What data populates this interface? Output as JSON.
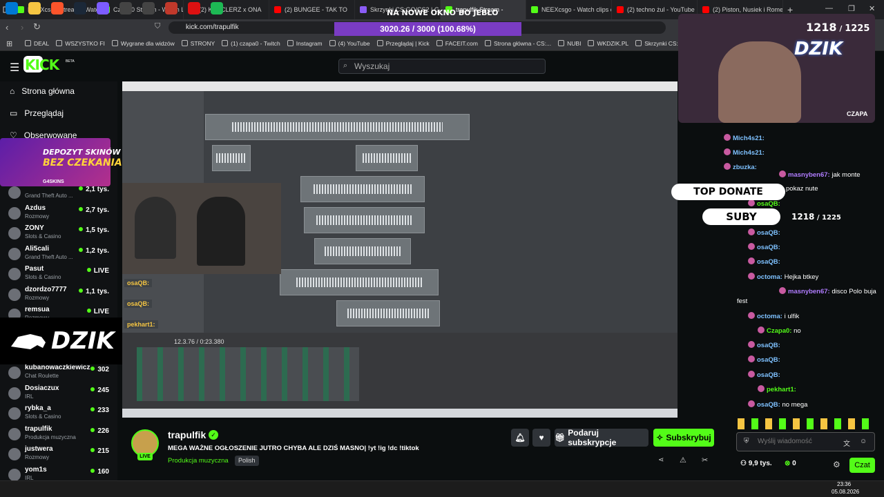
{
  "tabs": [
    {
      "label": "NEEXcsgo Stream - Watch",
      "color": "#53fc18"
    },
    {
      "label": "Czapa0 Stream - Watch Li",
      "color": "#53fc18"
    },
    {
      "label": "(2) KANCLERZ x ONA",
      "color": "#ff0000"
    },
    {
      "label": "(2) BUNGEE - TAK TO",
      "color": "#ff0000"
    },
    {
      "label": "Skrzynki CS:GO/CS2 | G4",
      "color": "#8b5cf6"
    },
    {
      "label": "trapulfik Stream -",
      "color": "#53fc18",
      "active": true
    },
    {
      "label": "NEEXcsgo - Watch clips c",
      "color": "#53fc18"
    },
    {
      "label": "(2) techno żul - YouTube",
      "color": "#ff0000"
    },
    {
      "label": "(2) Piston, Nusiek i Romeo",
      "color": "#ff0000"
    }
  ],
  "window_controls": {
    "new_tab": "+",
    "minimize": "—",
    "maximize": "❐",
    "close": "✕"
  },
  "address": "kick.com/trapulfik",
  "overlay": {
    "top_banner": "NA NOWE OKNO BO JEBŁO",
    "goal": "3020.26 / 3000 (100.68%)",
    "subs_current": "1218",
    "subs_goal": "1225",
    "dzik": "DZIK",
    "cam_name": "CZAPA",
    "top_donate": "TOP DONATE",
    "suby": "SUBY",
    "subs_suby": "1218",
    "subs_suby_goal": "1225",
    "promo_line1": "DEPOZYT SKINÓW",
    "promo_line2": "BEZ CZEKANIA!",
    "promo_brand": "G4SKINS",
    "dzik_logo": "DZIK"
  },
  "bookmarks": [
    "DEAL",
    "WSZYSTKO FI",
    "Wygrane dla widzów",
    "STRONY",
    "(1) czapa0 - Twitch",
    "Instagram",
    "(4) YouTube",
    "Przeglądaj | Kick",
    "FACEIT.com",
    "Strona główna - CS:...",
    "NUBI",
    "WKDZIK.PL",
    "Skrzynki CS:GO/CS"
  ],
  "kick": {
    "logo": "KICK",
    "beta": "BETA",
    "search_placeholder": "Wyszukaj"
  },
  "sidebar": {
    "nav": [
      {
        "label": "Strona główna",
        "icon": "home-icon"
      },
      {
        "label": "Przeglądaj",
        "icon": "browse-icon"
      },
      {
        "label": "Obserwowane",
        "icon": "heart-icon"
      }
    ],
    "channels_top": [
      {
        "name": "",
        "category": "Grand Theft Auto ...",
        "viewers": "2,1 tys."
      },
      {
        "name": "Azdus",
        "category": "Rozmowy",
        "viewers": "2,7 tys."
      },
      {
        "name": "ZONY",
        "category": "Slots & Casino",
        "viewers": "1,5 tys."
      },
      {
        "name": "Ali5cali",
        "category": "Grand Theft Auto ...",
        "viewers": "1,2 tys."
      },
      {
        "name": "Pasut",
        "category": "Slots & Casino",
        "viewers": "LIVE"
      },
      {
        "name": "dzordzo7777",
        "category": "Rozmowy",
        "viewers": "1,1 tys."
      },
      {
        "name": "remsua",
        "category": "Rozmowy",
        "viewers": "LIVE"
      }
    ],
    "channels_bottom": [
      {
        "name": "kubanowaczkiewicz",
        "category": "Chat Roulette",
        "viewers": "302"
      },
      {
        "name": "Dosiaczux",
        "category": "IRL",
        "viewers": "245"
      },
      {
        "name": "rybka_a",
        "category": "Slots & Casino",
        "viewers": "233"
      },
      {
        "name": "trapulfik",
        "category": "Produkcja muzyczna",
        "viewers": "226"
      },
      {
        "name": "justwera",
        "category": "Rozmowy",
        "viewers": "215"
      },
      {
        "name": "yom1s",
        "category": "IRL",
        "viewers": "160"
      }
    ]
  },
  "video": {
    "time": "12.3.76 / 0:23.380",
    "facecam_labels": [
      "osaQB:",
      "osaQB:",
      "pekhart1:"
    ]
  },
  "stream": {
    "channel": "trapulfik",
    "title": "MEGA WAŻNE OGŁOSZENIE JUTRO CHYBA ALE DZIŚ MASNO| !yt !ig !dc !tiktok",
    "category": "Produkcja muzyczna",
    "tag": "Polish",
    "live": "LIVE",
    "gift_label": "Podaruj subskrypcje",
    "subscribe_label": "Subskrybuj",
    "viewers": "9,9 tys.",
    "kicks": "0"
  },
  "chat": {
    "messages": [
      {
        "user": "Mich4s21:",
        "text": "",
        "color": "#7ec1ff"
      },
      {
        "user": "Mich4s21:",
        "text": "",
        "color": "#7ec1ff"
      },
      {
        "user": "zbuzka:",
        "text": "",
        "color": "#7ec1ff"
      },
      {
        "user": "masnyben67:",
        "text": "jak monte",
        "color": "#b07cff"
      },
      {
        "user": "",
        "text": "pokaz nute",
        "color": "#fff"
      },
      {
        "user": "osaQB:",
        "text": "",
        "color": "#53fc18"
      },
      {
        "user": "osaQB:",
        "text": "",
        "color": "#7ec1ff"
      },
      {
        "user": "osaQB:",
        "text": "",
        "color": "#7ec1ff"
      },
      {
        "user": "osaQB:",
        "text": "",
        "color": "#7ec1ff"
      },
      {
        "user": "octoma:",
        "text": "Hejka btkey",
        "color": "#7ec1ff"
      },
      {
        "user": "masnyben67:",
        "text": "disco Polo buja",
        "color": "#b07cff"
      },
      {
        "user": "",
        "text": "fest",
        "color": "#fff"
      },
      {
        "user": "octoma:",
        "text": "i ulfik",
        "color": "#7ec1ff"
      },
      {
        "user": "Czapa0:",
        "text": "no",
        "color": "#53fc18"
      },
      {
        "user": "osaQB:",
        "text": "",
        "color": "#7ec1ff"
      },
      {
        "user": "osaQB:",
        "text": "",
        "color": "#7ec1ff"
      },
      {
        "user": "osaQB:",
        "text": "",
        "color": "#7ec1ff"
      },
      {
        "user": "pekhart1:",
        "text": "",
        "color": "#53fc18"
      },
      {
        "user": "osaQB:",
        "text": "no mega",
        "color": "#7ec1ff"
      }
    ],
    "input_placeholder": "Wyślij wiadomość",
    "send_label": "Czat"
  },
  "taskbar": {
    "time": "23:36",
    "date": "05.08.2026"
  },
  "colors": {
    "kick_green": "#53fc18",
    "bg": "#0b0e0f",
    "overlay_purple": "#7a3cc4"
  }
}
